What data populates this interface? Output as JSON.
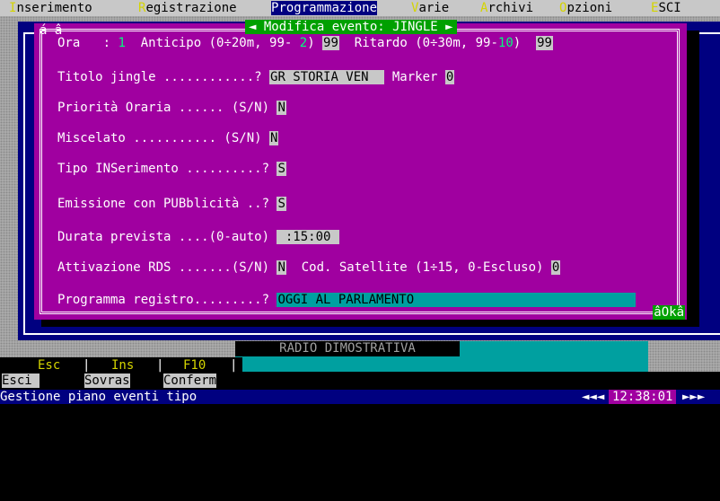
{
  "menu": {
    "items": [
      {
        "hotkey": "I",
        "rest": "nserimento"
      },
      {
        "hotkey": "R",
        "rest": "egistrazione"
      },
      {
        "hotkey": "P",
        "rest": "rogrammazione"
      },
      {
        "hotkey": "V",
        "rest": "arie"
      },
      {
        "hotkey": "A",
        "rest": "rchivi"
      },
      {
        "hotkey": "O",
        "rest": "pzioni"
      },
      {
        "hotkey": "E",
        "rest": "SCI"
      }
    ]
  },
  "dialog": {
    "title": "◄ Modifica evento: JINGLE ►",
    "corner": "á â",
    "ok_label": "âOkâ",
    "ora_label": "Ora   : ",
    "ora_value": "1",
    "anticipo_label": "  Anticipo (0÷20m, 99- ",
    "anticipo_range": "2",
    "anticipo_close": ") ",
    "anticipo_value": "99",
    "ritardo_label": "  Ritardo (0÷30m, 99-",
    "ritardo_range": "10",
    "ritardo_close": ")  ",
    "ritardo_value": "99",
    "titolo_label": "Titolo jingle ............? ",
    "titolo_value": "GR STORIA VEN  ",
    "marker_label": " Marker ",
    "marker_value": "0",
    "priorita_label": "Priorità Oraria ...... (S/N) ",
    "priorita_value": "N",
    "miscelato_label": "Miscelato ........... (S/N) ",
    "miscelato_value": "N",
    "tipo_label": "Tipo INSerimento ..........? ",
    "tipo_value": "S",
    "emissione_label": "Emissione con PUBblicità ..? ",
    "emissione_value": "S",
    "durata_label": "Durata prevista ....(0-auto) ",
    "durata_value": " :15:00 ",
    "rds_label": "Attivazione RDS .......(S/N) ",
    "rds_value": "N",
    "satellite_label": "  Cod. Satellite (1÷15, 0-Escluso) ",
    "satellite_value": "0",
    "programma_label": "Programma registro.........? ",
    "programma_value": "OGGI AL PARLAMENTO"
  },
  "status_panel": {
    "radio_name": "RADIO DIMOSTRATIVA"
  },
  "keys": [
    {
      "key": "Esc",
      "text": "Esci "
    },
    {
      "key": "Ins",
      "text": "Sovras"
    },
    {
      "key": "F10",
      "text": "Conferm"
    }
  ],
  "statusbar": {
    "text": "Gestione piano eventi tipo",
    "clock": "12:38:01",
    "arrow_left": "◄◄◄",
    "arrow_right": "►►►"
  },
  "colors": {
    "dialog_bg": "#a000a0",
    "menu_bg": "#c8c8c8",
    "title_bg": "#00a000",
    "status_bg": "#000080",
    "panel_bg": "#00a0a0"
  }
}
